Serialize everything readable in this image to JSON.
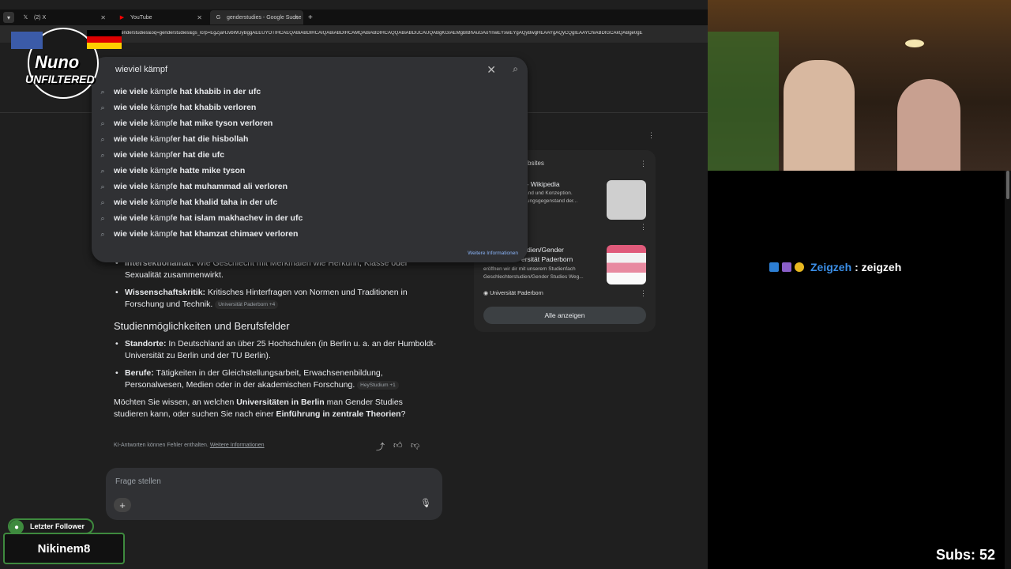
{
  "tabs": [
    {
      "label": "(2) X",
      "icon": "x-icon"
    },
    {
      "label": "YouTube",
      "icon": "youtube-icon"
    },
    {
      "label": "genderstudies - Google Suche",
      "icon": "google-icon"
    }
  ],
  "url": "/search?q=genderstudies&oq=genderstudies&gs_lcrp=EgZjaHJvbWUyBggAEEUYOTIHCAEQABiABDIHCAIQABiABDIHCAMQABiABDIHCAQQABiABDIJCAUQABgKGIAEMgBIBhAuGAoYnwEYxwEYgAQyBwgHEAAYgAQyCQgIEAAYChiABDIGCAkQABge0gE",
  "search": {
    "query": "wieviel kämpf",
    "suggestions": [
      {
        "prefix": "wie viele",
        "mid": " kämpf",
        "rest": "e hat khabib in der ufc"
      },
      {
        "prefix": "wie viele",
        "mid": " kämpf",
        "rest": "e hat khabib verloren"
      },
      {
        "prefix": "wie viele",
        "mid": " kämpf",
        "rest": "e hat mike tyson verloren"
      },
      {
        "prefix": "wie viele",
        "mid": " kämpf",
        "rest": "er hat die hisbollah"
      },
      {
        "prefix": "wie viele",
        "mid": " kämpf",
        "rest": "er hat die ufc"
      },
      {
        "prefix": "wie viele",
        "mid": " kämpf",
        "rest": "e hatte mike tyson"
      },
      {
        "prefix": "wie viele",
        "mid": " kämpf",
        "rest": "e hat muhammad ali verloren"
      },
      {
        "prefix": "wie viele",
        "mid": " kämpf",
        "rest": "e hat khalid taha in der ufc"
      },
      {
        "prefix": "wie viele",
        "mid": " kämpf",
        "rest": "e hat islam makhachev in der ufc"
      },
      {
        "prefix": "wie viele",
        "mid": " kämpf",
        "rest": "e hat khamzat chimaev verloren"
      }
    ],
    "more_info": "Weitere Informationen"
  },
  "ai": {
    "bullet1_bold": "Intersektionalität:",
    "bullet1_text": " Wie Geschlecht mit Merkmalen wie Herkunft, Klasse oder Sexualität zusammenwirkt.",
    "bullet2_bold": "Wissenschaftskritik:",
    "bullet2_text": " Kritisches Hinterfragen von Normen und Traditionen in Forschung und Technik.",
    "bullet2_chip": "Universität Paderborn +4",
    "heading": "Studienmöglichkeiten und Berufsfelder",
    "bullet3_bold": "Standorte:",
    "bullet3_text": " In Deutschland an über 25 Hochschulen (in Berlin u. a. an der Humboldt-Universität zu Berlin und der TU Berlin).",
    "bullet4_bold": "Berufe:",
    "bullet4_text": " Tätigkeiten in der Gleichstellungsarbeit, Erwachsenenbildung, Personalwesen, Medien oder in der akademischen Forschung.",
    "bullet4_chip": "HeyStudium +1",
    "para_1": "Möchten Sie wissen, an welchen ",
    "para_b1": "Universitäten in Berlin",
    "para_2": " man Gender Studies studieren kann, oder suchen Sie nach einer ",
    "para_b2": "Einführung in zentrale Theorien",
    "para_3": "?",
    "disclaimer": "KI-Antworten können Fehler enthalten.",
    "disclaimer_link": "Weitere Informationen",
    "ask_placeholder": "Frage stellen"
  },
  "sources": {
    "header": "bsites",
    "item1_title": "s - Wikipedia",
    "item1_desc": "stand und Konzeption.\nchungsgegenstand der...",
    "item2_title": "tudien/Gender\nersität Paderborn",
    "item2_desc": "eröffnen wir dir mit unserem Studienfach\nGeschlechterstudien/Gender Studies Weg...",
    "item2_source": "Universität Paderborn",
    "show_all": "Alle anzeigen"
  },
  "overlay": {
    "logo_line1": "Nuno",
    "logo_line2": "UNFILTERED",
    "chat_user": "Zeigzeh",
    "chat_msg": ": zeigzeh",
    "follower_label": "Letzter Follower",
    "follower_name": "Nikinem8",
    "subs": "Subs: 52"
  },
  "colors": {
    "accent": "#8ab4f8",
    "chat_user": "#3b8fe8",
    "follower_border": "#3e8a3e"
  }
}
